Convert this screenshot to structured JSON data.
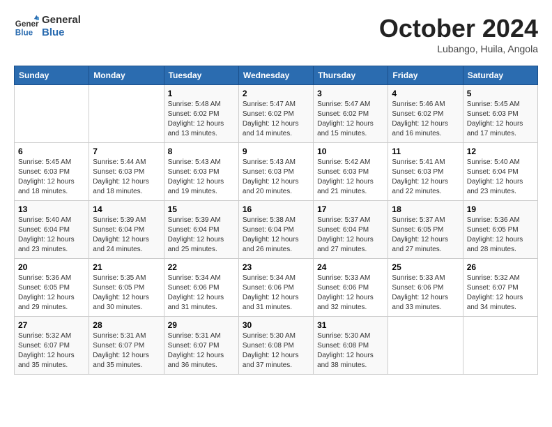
{
  "header": {
    "logo_line1": "General",
    "logo_line2": "Blue",
    "month": "October 2024",
    "location": "Lubango, Huila, Angola"
  },
  "weekdays": [
    "Sunday",
    "Monday",
    "Tuesday",
    "Wednesday",
    "Thursday",
    "Friday",
    "Saturday"
  ],
  "weeks": [
    [
      {
        "day": "",
        "info": ""
      },
      {
        "day": "",
        "info": ""
      },
      {
        "day": "1",
        "info": "Sunrise: 5:48 AM\nSunset: 6:02 PM\nDaylight: 12 hours and 13 minutes."
      },
      {
        "day": "2",
        "info": "Sunrise: 5:47 AM\nSunset: 6:02 PM\nDaylight: 12 hours and 14 minutes."
      },
      {
        "day": "3",
        "info": "Sunrise: 5:47 AM\nSunset: 6:02 PM\nDaylight: 12 hours and 15 minutes."
      },
      {
        "day": "4",
        "info": "Sunrise: 5:46 AM\nSunset: 6:02 PM\nDaylight: 12 hours and 16 minutes."
      },
      {
        "day": "5",
        "info": "Sunrise: 5:45 AM\nSunset: 6:03 PM\nDaylight: 12 hours and 17 minutes."
      }
    ],
    [
      {
        "day": "6",
        "info": "Sunrise: 5:45 AM\nSunset: 6:03 PM\nDaylight: 12 hours and 18 minutes."
      },
      {
        "day": "7",
        "info": "Sunrise: 5:44 AM\nSunset: 6:03 PM\nDaylight: 12 hours and 18 minutes."
      },
      {
        "day": "8",
        "info": "Sunrise: 5:43 AM\nSunset: 6:03 PM\nDaylight: 12 hours and 19 minutes."
      },
      {
        "day": "9",
        "info": "Sunrise: 5:43 AM\nSunset: 6:03 PM\nDaylight: 12 hours and 20 minutes."
      },
      {
        "day": "10",
        "info": "Sunrise: 5:42 AM\nSunset: 6:03 PM\nDaylight: 12 hours and 21 minutes."
      },
      {
        "day": "11",
        "info": "Sunrise: 5:41 AM\nSunset: 6:03 PM\nDaylight: 12 hours and 22 minutes."
      },
      {
        "day": "12",
        "info": "Sunrise: 5:40 AM\nSunset: 6:04 PM\nDaylight: 12 hours and 23 minutes."
      }
    ],
    [
      {
        "day": "13",
        "info": "Sunrise: 5:40 AM\nSunset: 6:04 PM\nDaylight: 12 hours and 23 minutes."
      },
      {
        "day": "14",
        "info": "Sunrise: 5:39 AM\nSunset: 6:04 PM\nDaylight: 12 hours and 24 minutes."
      },
      {
        "day": "15",
        "info": "Sunrise: 5:39 AM\nSunset: 6:04 PM\nDaylight: 12 hours and 25 minutes."
      },
      {
        "day": "16",
        "info": "Sunrise: 5:38 AM\nSunset: 6:04 PM\nDaylight: 12 hours and 26 minutes."
      },
      {
        "day": "17",
        "info": "Sunrise: 5:37 AM\nSunset: 6:04 PM\nDaylight: 12 hours and 27 minutes."
      },
      {
        "day": "18",
        "info": "Sunrise: 5:37 AM\nSunset: 6:05 PM\nDaylight: 12 hours and 27 minutes."
      },
      {
        "day": "19",
        "info": "Sunrise: 5:36 AM\nSunset: 6:05 PM\nDaylight: 12 hours and 28 minutes."
      }
    ],
    [
      {
        "day": "20",
        "info": "Sunrise: 5:36 AM\nSunset: 6:05 PM\nDaylight: 12 hours and 29 minutes."
      },
      {
        "day": "21",
        "info": "Sunrise: 5:35 AM\nSunset: 6:05 PM\nDaylight: 12 hours and 30 minutes."
      },
      {
        "day": "22",
        "info": "Sunrise: 5:34 AM\nSunset: 6:06 PM\nDaylight: 12 hours and 31 minutes."
      },
      {
        "day": "23",
        "info": "Sunrise: 5:34 AM\nSunset: 6:06 PM\nDaylight: 12 hours and 31 minutes."
      },
      {
        "day": "24",
        "info": "Sunrise: 5:33 AM\nSunset: 6:06 PM\nDaylight: 12 hours and 32 minutes."
      },
      {
        "day": "25",
        "info": "Sunrise: 5:33 AM\nSunset: 6:06 PM\nDaylight: 12 hours and 33 minutes."
      },
      {
        "day": "26",
        "info": "Sunrise: 5:32 AM\nSunset: 6:07 PM\nDaylight: 12 hours and 34 minutes."
      }
    ],
    [
      {
        "day": "27",
        "info": "Sunrise: 5:32 AM\nSunset: 6:07 PM\nDaylight: 12 hours and 35 minutes."
      },
      {
        "day": "28",
        "info": "Sunrise: 5:31 AM\nSunset: 6:07 PM\nDaylight: 12 hours and 35 minutes."
      },
      {
        "day": "29",
        "info": "Sunrise: 5:31 AM\nSunset: 6:07 PM\nDaylight: 12 hours and 36 minutes."
      },
      {
        "day": "30",
        "info": "Sunrise: 5:30 AM\nSunset: 6:08 PM\nDaylight: 12 hours and 37 minutes."
      },
      {
        "day": "31",
        "info": "Sunrise: 5:30 AM\nSunset: 6:08 PM\nDaylight: 12 hours and 38 minutes."
      },
      {
        "day": "",
        "info": ""
      },
      {
        "day": "",
        "info": ""
      }
    ]
  ]
}
